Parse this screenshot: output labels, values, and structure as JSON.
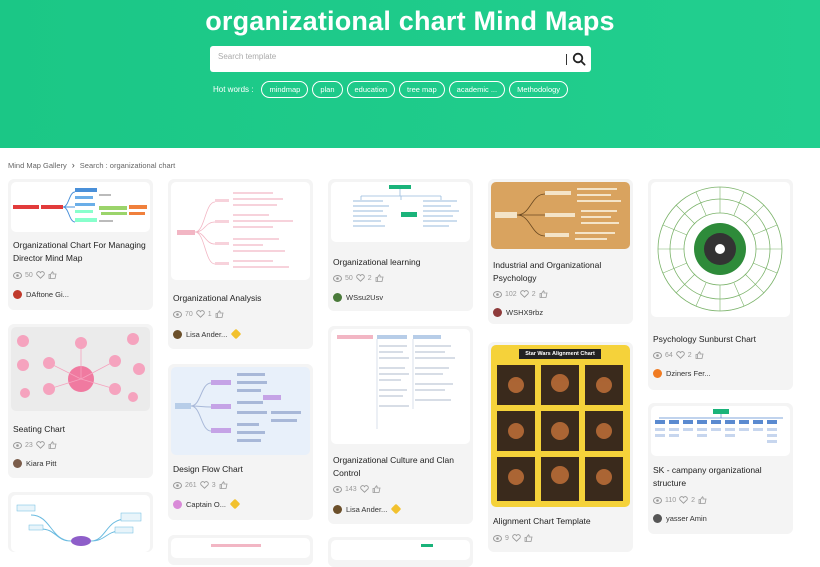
{
  "header": {
    "title": "organizational chart Mind Maps",
    "search_placeholder": "Search template",
    "hot_label": "Hot words :",
    "hot_words": [
      "mindmap",
      "plan",
      "education",
      "tree map",
      "academic ...",
      "Methodology"
    ]
  },
  "breadcrumb": {
    "home": "Mind Map Gallery",
    "search": "Search : organizational chart"
  },
  "cards": [
    {
      "title": "Organizational Chart For Managing Director Mind Map",
      "views": "50",
      "likes": "",
      "author": "DAftone Gi..."
    },
    {
      "title": "Organizational Analysis",
      "views": "70",
      "likes": "1",
      "author": "Lisa Ander..."
    },
    {
      "title": "Organizational learning",
      "views": "50",
      "likes": "2",
      "author": "WSsu2Usv"
    },
    {
      "title": "Industrial and Organizational Psychology",
      "views": "102",
      "likes": "2",
      "author": "WSHX9rbz"
    },
    {
      "title": "Psychology Sunburst Chart",
      "views": "64",
      "likes": "2",
      "author": "Dziners Fer..."
    },
    {
      "title": "Seating Chart",
      "views": "23",
      "likes": "",
      "author": "Kiara Pitt"
    },
    {
      "title": "Design Flow Chart",
      "views": "261",
      "likes": "3",
      "author": "Captain O..."
    },
    {
      "title": "Organizational Culture and Clan Control",
      "views": "143",
      "likes": "",
      "author": "Lisa Ander..."
    },
    {
      "title": "Alignment Chart Template",
      "views": "9",
      "likes": "",
      "author": ""
    },
    {
      "title": "SK - campany organizational structure",
      "views": "110",
      "likes": "2",
      "author": "yasser Amin"
    }
  ],
  "thumb_texts": {
    "alignment_header": "Star Wars Alignment Chart"
  },
  "colors": {
    "accent": "#1ec98a",
    "badge": "#f2c12e"
  }
}
